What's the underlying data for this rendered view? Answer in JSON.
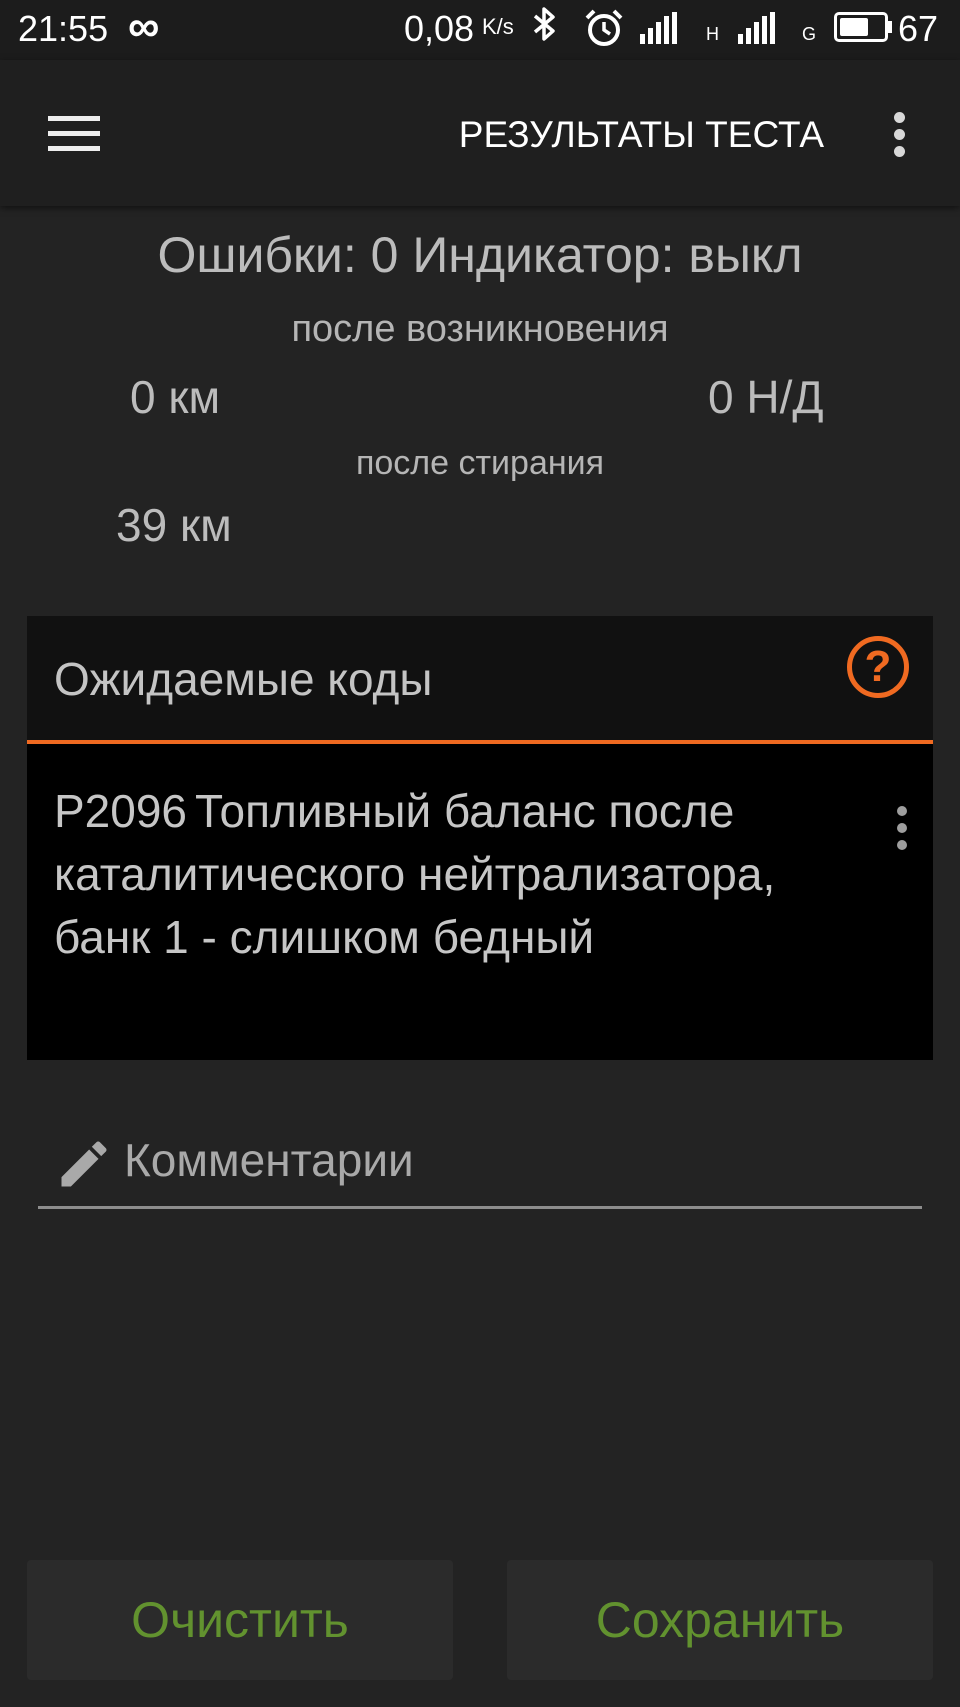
{
  "status_bar": {
    "time": "21:55",
    "sync_icon": "∞",
    "speed": "0,08",
    "speed_unit": "K/s",
    "net_h": "H",
    "net_g": "G",
    "battery_level": 0.67,
    "battery_percent": "67"
  },
  "toolbar": {
    "title": "РЕЗУЛЬТАТЫ ТЕСТА"
  },
  "summary": {
    "errors_line": "Ошибки: 0 Индикатор: выкл",
    "after_occurrence_label": "после возникновения",
    "after_occurrence_km": "0 км",
    "after_occurrence_nd": "0 Н/Д",
    "after_clear_label": "после стирания",
    "after_clear_km": "39 км"
  },
  "pending": {
    "title": "Ожидаемые коды",
    "codes": [
      {
        "code": "P2096",
        "description": "Топливный баланс после каталитического нейтрализатора, банк 1 - слишком бедный"
      }
    ]
  },
  "comment": {
    "placeholder": "Комментарии",
    "value": ""
  },
  "buttons": {
    "clear": "Очистить",
    "save": "Сохранить"
  },
  "colors": {
    "accent": "#f06a21",
    "button_text": "#62922f",
    "background": "#232323"
  }
}
